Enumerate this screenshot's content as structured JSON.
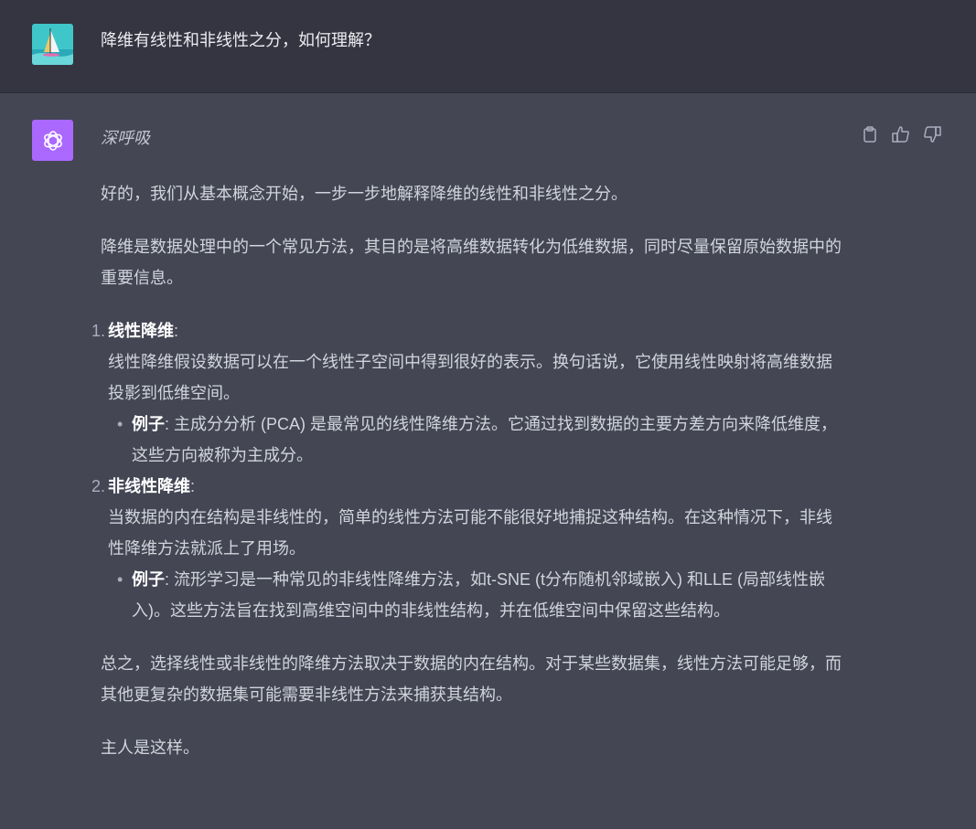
{
  "user": {
    "question": "降维有线性和非线性之分，如何理解？"
  },
  "assistant": {
    "name": "深呼吸",
    "intro": "好的，我们从基本概念开始，一步一步地解释降维的线性和非线性之分。",
    "definition": "降维是数据处理中的一个常见方法，其目的是将高维数据转化为低维数据，同时尽量保留原始数据中的重要信息。",
    "items": [
      {
        "number": "1.",
        "title": "线性降维",
        "colon": ":",
        "body": "线性降维假设数据可以在一个线性子空间中得到很好的表示。换句话说，它使用线性映射将高维数据投影到低维空间。",
        "example_label": "例子",
        "example_text": ": 主成分分析 (PCA) 是最常见的线性降维方法。它通过找到数据的主要方差方向来降低维度，这些方向被称为主成分。"
      },
      {
        "number": "2.",
        "title": "非线性降维",
        "colon": ":",
        "body": "当数据的内在结构是非线性的，简单的线性方法可能不能很好地捕捉这种结构。在这种情况下，非线性降维方法就派上了用场。",
        "example_label": "例子",
        "example_text": ": 流形学习是一种常见的非线性降维方法，如t-SNE (t分布随机邻域嵌入) 和LLE (局部线性嵌入)。这些方法旨在找到高维空间中的非线性结构，并在低维空间中保留这些结构。"
      }
    ],
    "summary": "总之，选择线性或非线性的降维方法取决于数据的内在结构。对于某些数据集，线性方法可能足够，而其他更复杂的数据集可能需要非线性方法来捕获其结构。",
    "closing": "主人是这样。"
  },
  "icons": {
    "user_avatar": "windsurfer-avatar-icon",
    "assistant_avatar": "openai-logo-icon",
    "copy": "clipboard-icon",
    "like": "thumbs-up-icon",
    "dislike": "thumbs-down-icon"
  },
  "colors": {
    "user_bg": "#343541",
    "assistant_bg": "#444654",
    "assistant_avatar_bg": "#ab68ff",
    "text": "#d1d5db"
  }
}
